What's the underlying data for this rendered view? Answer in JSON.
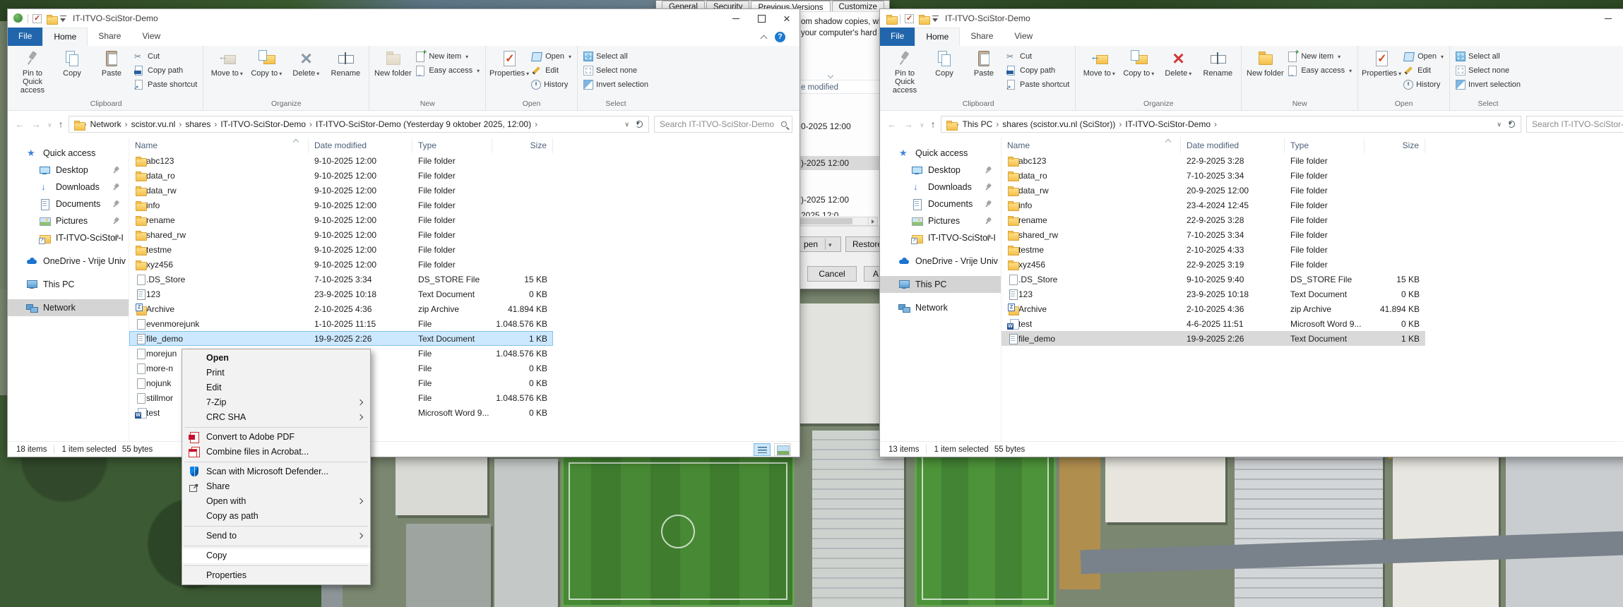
{
  "ribbon": {
    "groups": {
      "clipboard": "Clipboard",
      "organize": "Organize",
      "new": "New",
      "open": "Open",
      "select": "Select"
    },
    "labels": {
      "pin": "Pin to Quick access",
      "copy": "Copy",
      "paste": "Paste",
      "cut": "Cut",
      "copy_path": "Copy path",
      "paste_shortcut": "Paste shortcut",
      "move_to": "Move to",
      "copy_to": "Copy to",
      "delete": "Delete",
      "rename": "Rename",
      "new_folder": "New folder",
      "new_item": "New item",
      "easy_access": "Easy access",
      "properties": "Properties",
      "open": "Open",
      "edit": "Edit",
      "history": "History",
      "select_all": "Select all",
      "select_none": "Select none",
      "invert": "Invert selection"
    }
  },
  "dialog": {
    "tabs": [
      {
        "t": "General",
        "cls": ""
      },
      {
        "t": "Security",
        "cls": ""
      },
      {
        "t": "Previous Versions",
        "cls": "active"
      },
      {
        "t": "Customize",
        "cls": ""
      }
    ],
    "desc_line1": "om shadow copies, whi",
    "desc_line2": "your computer's hard d",
    "col_header": "e modified",
    "rows": [
      {
        "t": "0-2025 12:00",
        "cls": ""
      },
      {
        "t": ")-2025 12:00",
        "cls": "sel"
      },
      {
        "t": ")-2025 12:00",
        "cls": ""
      },
      {
        "t": "2025 12:0",
        "cls": "clip"
      }
    ],
    "open_fragment": "pen",
    "restore_label": "Restore",
    "cancel_label": "Cancel",
    "apply_fragment": "A"
  },
  "context_menu": {
    "items": [
      {
        "label": "Open",
        "cls": "bold",
        "icon": ""
      },
      {
        "label": "Print",
        "cls": "",
        "icon": ""
      },
      {
        "label": "Edit",
        "cls": "",
        "icon": ""
      },
      {
        "label": "7-Zip",
        "cls": "sub",
        "icon": ""
      },
      {
        "label": "CRC SHA",
        "cls": "sub",
        "icon": ""
      },
      {
        "cls": "sep"
      },
      {
        "label": "Convert to Adobe PDF",
        "cls": "",
        "icon": "adobepdf"
      },
      {
        "label": "Combine files in Acrobat...",
        "cls": "",
        "icon": "acrobat"
      },
      {
        "cls": "sep"
      },
      {
        "label": "Scan with Microsoft Defender...",
        "cls": "",
        "icon": "defender"
      },
      {
        "label": "Share",
        "cls": "",
        "icon": "share16"
      },
      {
        "label": "Open with",
        "cls": "sub",
        "icon": ""
      },
      {
        "label": "Copy as path",
        "cls": "",
        "icon": ""
      },
      {
        "cls": "sep"
      },
      {
        "label": "Send to",
        "cls": "sub",
        "icon": ""
      },
      {
        "cls": "sep"
      },
      {
        "label": "Copy",
        "cls": "hover",
        "icon": ""
      },
      {
        "cls": "sep"
      },
      {
        "label": "Properties",
        "cls": "",
        "icon": ""
      }
    ]
  },
  "windows": {
    "left": {
      "title": "IT-ITVO-SciStor-Demo",
      "menu_tabs": [
        {
          "t": "File",
          "cls": "file"
        },
        {
          "t": "Home",
          "cls": "active"
        },
        {
          "t": "Share",
          "cls": ""
        },
        {
          "t": "View",
          "cls": ""
        }
      ],
      "breadcrumb": [
        {
          "t": "Network"
        },
        {
          "t": "scistor.vu.nl"
        },
        {
          "t": "shares"
        },
        {
          "t": "IT-ITVO-SciStor-Demo"
        },
        {
          "t": "IT-ITVO-SciStor-Demo (Yesterday 9 oktober 2025, 12:00)"
        }
      ],
      "search_placeholder": "Search IT-ITVO-SciStor-Demo",
      "columns": [
        {
          "t": "Name",
          "cls": "c-name"
        },
        {
          "t": "Date modified",
          "cls": "c-date"
        },
        {
          "t": "Type",
          "cls": "c-type"
        },
        {
          "t": "Size",
          "cls": "c-size"
        }
      ],
      "sidebar": [
        {
          "label": "Quick access",
          "icon": "star",
          "cls": ""
        },
        {
          "label": "Desktop",
          "icon": "desktop",
          "cls": "lvl1 pinned"
        },
        {
          "label": "Downloads",
          "icon": "download",
          "cls": "lvl1 pinned"
        },
        {
          "label": "Documents",
          "icon": "docu",
          "cls": "lvl1 pinned"
        },
        {
          "label": "Pictures",
          "icon": "pictures",
          "cls": "lvl1 pinned"
        },
        {
          "label": "IT-ITVO-SciStor-I",
          "icon": "folderlink",
          "cls": "lvl1 pinned"
        },
        {
          "label": "OneDrive - Vrije Univ",
          "icon": "onedrive",
          "cls": "gap"
        },
        {
          "label": "This PC",
          "icon": "thispc",
          "cls": "gap"
        },
        {
          "label": "Network",
          "icon": "network",
          "cls": "gap sel"
        }
      ],
      "files": [
        {
          "name": "abc123",
          "date": "9-10-2025 12:00",
          "type": "File folder",
          "size": "",
          "icon": "folder",
          "cls": ""
        },
        {
          "name": "data_ro",
          "date": "9-10-2025 12:00",
          "type": "File folder",
          "size": "",
          "icon": "folder",
          "cls": ""
        },
        {
          "name": "data_rw",
          "date": "9-10-2025 12:00",
          "type": "File folder",
          "size": "",
          "icon": "folder",
          "cls": ""
        },
        {
          "name": "info",
          "date": "9-10-2025 12:00",
          "type": "File folder",
          "size": "",
          "icon": "folder",
          "cls": ""
        },
        {
          "name": "rename",
          "date": "9-10-2025 12:00",
          "type": "File folder",
          "size": "",
          "icon": "folder",
          "cls": ""
        },
        {
          "name": "shared_rw",
          "date": "9-10-2025 12:00",
          "type": "File folder",
          "size": "",
          "icon": "folder",
          "cls": ""
        },
        {
          "name": "testme",
          "date": "9-10-2025 12:00",
          "type": "File folder",
          "size": "",
          "icon": "folder",
          "cls": ""
        },
        {
          "name": "xyz456",
          "date": "9-10-2025 12:00",
          "type": "File folder",
          "size": "",
          "icon": "folder",
          "cls": ""
        },
        {
          "name": ".DS_Store",
          "date": "7-10-2025 3:34",
          "type": "DS_STORE File",
          "size": "15 KB",
          "icon": "file",
          "cls": ""
        },
        {
          "name": "123",
          "date": "23-9-2025 10:18",
          "type": "Text Document",
          "size": "0 KB",
          "icon": "text",
          "cls": ""
        },
        {
          "name": "Archive",
          "date": "2-10-2025 4:36",
          "type": "zip Archive",
          "size": "41.894 KB",
          "icon": "zip",
          "cls": ""
        },
        {
          "name": "evenmorejunk",
          "date": "1-10-2025 11:15",
          "type": "File",
          "size": "1.048.576 KB",
          "icon": "file",
          "cls": ""
        },
        {
          "name": "file_demo",
          "date": "19-9-2025 2:26",
          "type": "Text Document",
          "size": "1 KB",
          "icon": "text",
          "cls": "sel-a"
        },
        {
          "name": "morejun",
          "date": "",
          "type": "File",
          "size": "1.048.576 KB",
          "icon": "file",
          "cls": ""
        },
        {
          "name": "more-n",
          "date": "",
          "type": "File",
          "size": "0 KB",
          "icon": "file",
          "cls": ""
        },
        {
          "name": "nojunk",
          "date": "",
          "type": "File",
          "size": "0 KB",
          "icon": "file",
          "cls": ""
        },
        {
          "name": "stillmor",
          "date": "",
          "type": "File",
          "size": "1.048.576 KB",
          "icon": "file",
          "cls": ""
        },
        {
          "name": "test",
          "date": "",
          "type": "Microsoft Word 9...",
          "size": "0 KB",
          "icon": "word",
          "cls": ""
        }
      ],
      "status_items": "18 items",
      "status_selected": "1 item selected",
      "status_size": "55 bytes"
    },
    "right": {
      "title": "IT-ITVO-SciStor-Demo",
      "menu_tabs": [
        {
          "t": "File",
          "cls": "file"
        },
        {
          "t": "Home",
          "cls": "active"
        },
        {
          "t": "Share",
          "cls": ""
        },
        {
          "t": "View",
          "cls": ""
        }
      ],
      "breadcrumb": [
        {
          "t": "This PC"
        },
        {
          "t": "shares (scistor.vu.nl (SciStor))"
        },
        {
          "t": "IT-ITVO-SciStor-Demo"
        }
      ],
      "search_placeholder": "Search IT-ITVO-SciStor-De",
      "columns": [
        {
          "t": "Name",
          "cls": "c-name"
        },
        {
          "t": "Date modified",
          "cls": "c-date"
        },
        {
          "t": "Type",
          "cls": "c-type"
        },
        {
          "t": "Size",
          "cls": "c-size"
        }
      ],
      "sidebar": [
        {
          "label": "Quick access",
          "icon": "star",
          "cls": ""
        },
        {
          "label": "Desktop",
          "icon": "desktop",
          "cls": "lvl1 pinned"
        },
        {
          "label": "Downloads",
          "icon": "download",
          "cls": "lvl1 pinned"
        },
        {
          "label": "Documents",
          "icon": "docu",
          "cls": "lvl1 pinned"
        },
        {
          "label": "Pictures",
          "icon": "pictures",
          "cls": "lvl1 pinned"
        },
        {
          "label": "IT-ITVO-SciStor-I",
          "icon": "folderlink",
          "cls": "lvl1 pinned"
        },
        {
          "label": "OneDrive - Vrije Univ",
          "icon": "onedrive",
          "cls": "gap"
        },
        {
          "label": "This PC",
          "icon": "thispc",
          "cls": "gap sel"
        },
        {
          "label": "Network",
          "icon": "network",
          "cls": "gap"
        }
      ],
      "files": [
        {
          "name": "abc123",
          "date": "22-9-2025 3:28",
          "type": "File folder",
          "size": "",
          "icon": "folder",
          "cls": ""
        },
        {
          "name": "data_ro",
          "date": "7-10-2025 3:34",
          "type": "File folder",
          "size": "",
          "icon": "folder",
          "cls": ""
        },
        {
          "name": "data_rw",
          "date": "20-9-2025 12:00",
          "type": "File folder",
          "size": "",
          "icon": "folder",
          "cls": ""
        },
        {
          "name": "info",
          "date": "23-4-2024 12:45",
          "type": "File folder",
          "size": "",
          "icon": "folder",
          "cls": ""
        },
        {
          "name": "rename",
          "date": "22-9-2025 3:28",
          "type": "File folder",
          "size": "",
          "icon": "folder",
          "cls": ""
        },
        {
          "name": "shared_rw",
          "date": "7-10-2025 3:34",
          "type": "File folder",
          "size": "",
          "icon": "folder",
          "cls": ""
        },
        {
          "name": "testme",
          "date": "2-10-2025 4:33",
          "type": "File folder",
          "size": "",
          "icon": "folder",
          "cls": ""
        },
        {
          "name": "xyz456",
          "date": "22-9-2025 3:19",
          "type": "File folder",
          "size": "",
          "icon": "folder",
          "cls": ""
        },
        {
          "name": ".DS_Store",
          "date": "9-10-2025 9:40",
          "type": "DS_STORE File",
          "size": "15 KB",
          "icon": "file",
          "cls": ""
        },
        {
          "name": "123",
          "date": "23-9-2025 10:18",
          "type": "Text Document",
          "size": "0 KB",
          "icon": "text",
          "cls": ""
        },
        {
          "name": "Archive",
          "date": "2-10-2025 4:36",
          "type": "zip Archive",
          "size": "41.894 KB",
          "icon": "zip",
          "cls": ""
        },
        {
          "name": "test",
          "date": "4-6-2025 11:51",
          "type": "Microsoft Word 9...",
          "size": "0 KB",
          "icon": "word",
          "cls": ""
        },
        {
          "name": "file_demo",
          "date": "19-9-2025 2:26",
          "type": "Text Document",
          "size": "1 KB",
          "icon": "text",
          "cls": "sel-i"
        }
      ],
      "status_items": "13 items",
      "status_selected": "1 item selected",
      "status_size": "55 bytes"
    }
  }
}
